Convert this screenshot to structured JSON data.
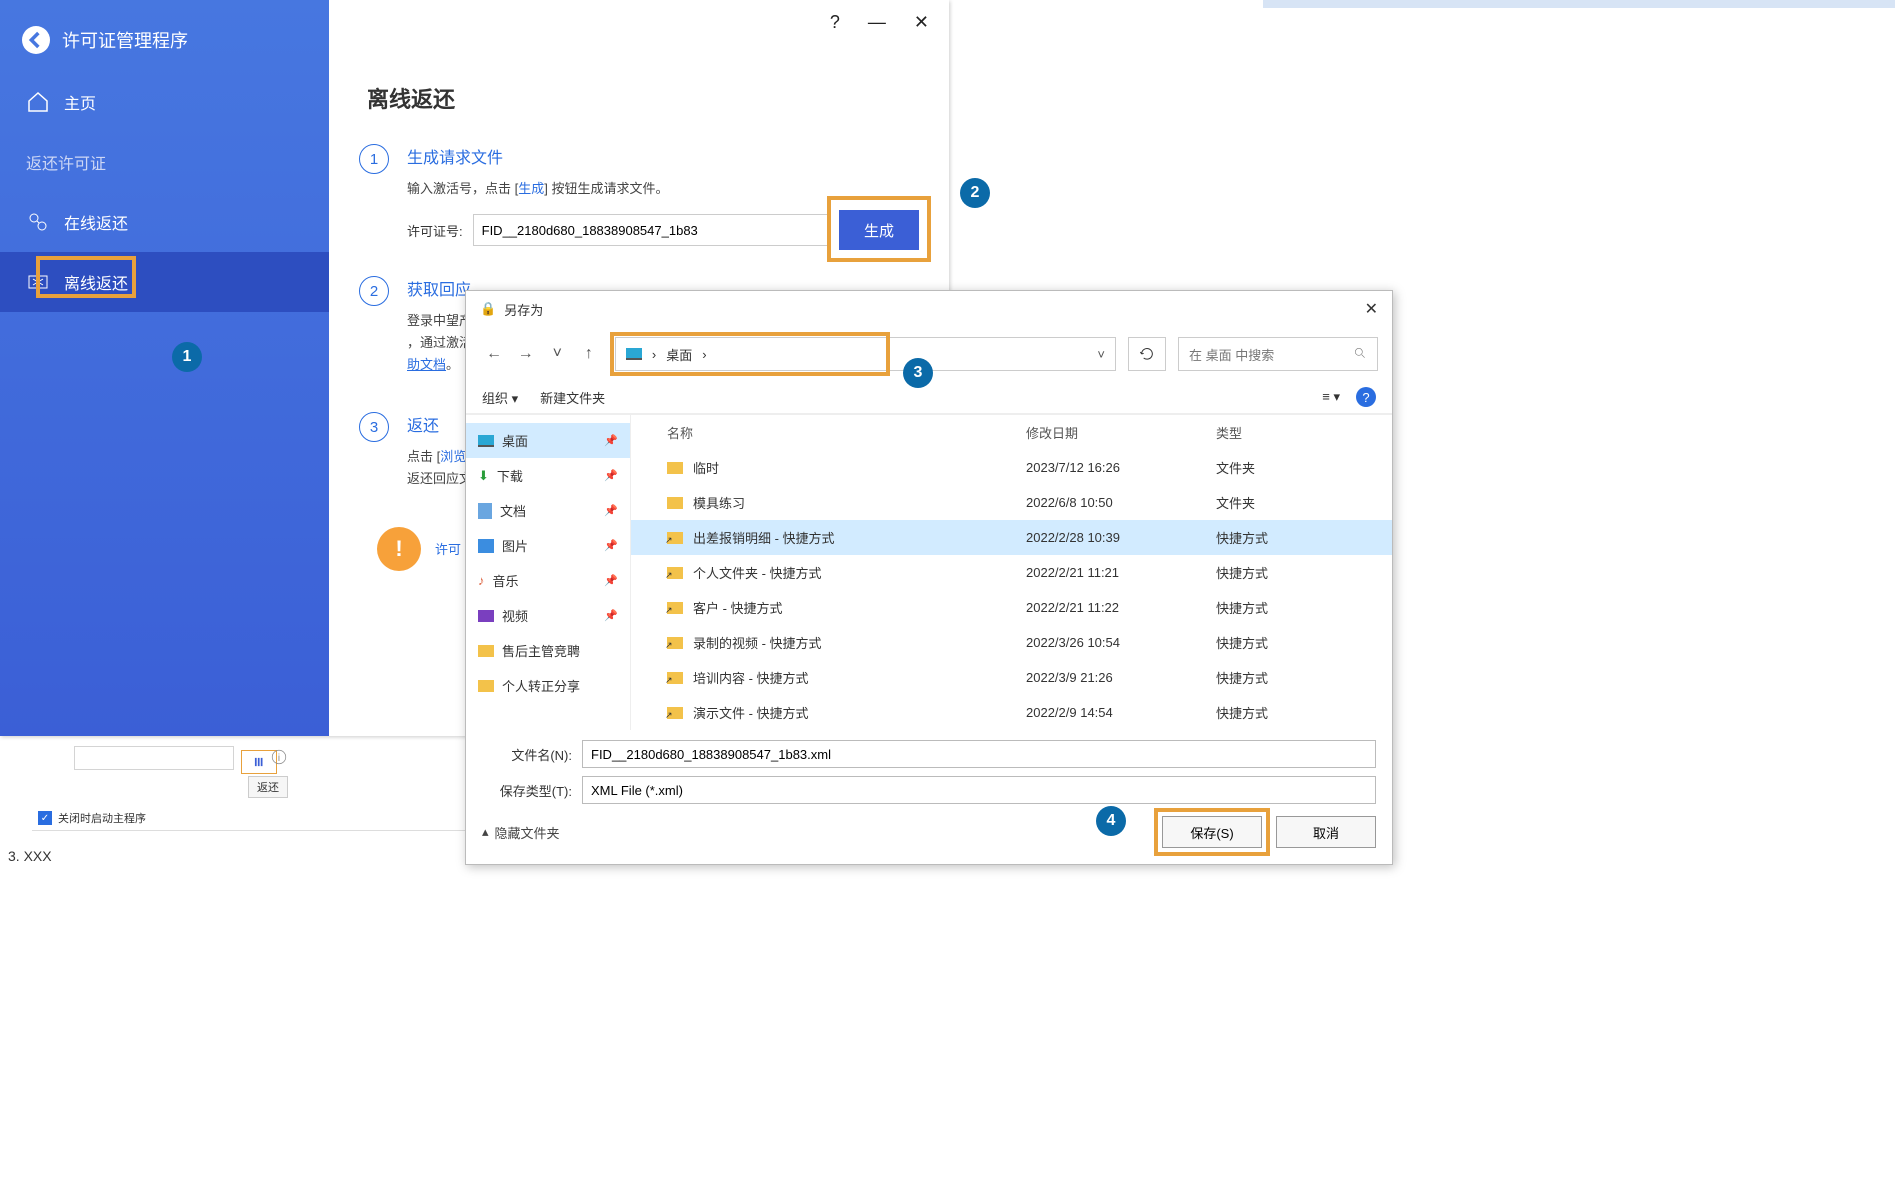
{
  "app": {
    "title": "许可证管理程序",
    "sidebar": {
      "home": "主页",
      "section": "返还许可证",
      "online": "在线返还",
      "offline": "离线返还"
    },
    "window_buttons": {
      "help": "?",
      "min": "—",
      "close": "✕"
    }
  },
  "content": {
    "heading": "离线返还",
    "step1": {
      "title": "生成请求文件",
      "desc_pre": "输入激活号，点击 [",
      "desc_link": "生成",
      "desc_post": "] 按钮生成请求文件。",
      "lic_label": "许可证号:",
      "lic_value": "FID__2180d680_18838908547_1b83",
      "btn": "生成"
    },
    "step2": {
      "title": "获取回应",
      "desc_pre": "登录中望产",
      "desc_post": "，通过激活",
      "link": "助文档"
    },
    "step3": {
      "title": "返还",
      "desc_pre": "点击 [",
      "desc_link": "浏览",
      "desc_post": "]",
      "desc2": "返还回应文"
    },
    "warn_text": "许可"
  },
  "mini": {
    "tooltip": "返还",
    "checkbox_label": "关闭时启动主程序"
  },
  "footer_text": "3. XXX",
  "dialog": {
    "title": "另存为",
    "breadcrumb": {
      "loc": "桌面",
      "sep": "›"
    },
    "search_placeholder": "在 桌面 中搜索",
    "toolbar": {
      "organize": "组织",
      "new_folder": "新建文件夹"
    },
    "tree": [
      {
        "label": "桌面",
        "icon": "desktop",
        "sel": true,
        "pin": true
      },
      {
        "label": "下载",
        "icon": "download",
        "pin": true
      },
      {
        "label": "文档",
        "icon": "doc",
        "pin": true
      },
      {
        "label": "图片",
        "icon": "img",
        "pin": true
      },
      {
        "label": "音乐",
        "icon": "music",
        "pin": true
      },
      {
        "label": "视频",
        "icon": "video",
        "pin": true
      },
      {
        "label": "售后主管竞聘",
        "icon": "folder"
      },
      {
        "label": "个人转正分享",
        "icon": "folder"
      }
    ],
    "columns": {
      "name": "名称",
      "date": "修改日期",
      "type": "类型"
    },
    "files": [
      {
        "name": "临时",
        "date": "2023/7/12 16:26",
        "type": "文件夹",
        "icon": "folder"
      },
      {
        "name": "模具练习",
        "date": "2022/6/8 10:50",
        "type": "文件夹",
        "icon": "folder"
      },
      {
        "name": "出差报销明细 - 快捷方式",
        "date": "2022/2/28 10:39",
        "type": "快捷方式",
        "icon": "shortcut",
        "sel": true
      },
      {
        "name": "个人文件夹 - 快捷方式",
        "date": "2022/2/21 11:21",
        "type": "快捷方式",
        "icon": "shortcut"
      },
      {
        "name": "客户 - 快捷方式",
        "date": "2022/2/21 11:22",
        "type": "快捷方式",
        "icon": "shortcut"
      },
      {
        "name": "录制的视频 - 快捷方式",
        "date": "2022/3/26 10:54",
        "type": "快捷方式",
        "icon": "shortcut"
      },
      {
        "name": "培训内容 - 快捷方式",
        "date": "2022/3/9 21:26",
        "type": "快捷方式",
        "icon": "shortcut"
      },
      {
        "name": "演示文件 - 快捷方式",
        "date": "2022/2/9 14:54",
        "type": "快捷方式",
        "icon": "shortcut"
      }
    ],
    "filename_label": "文件名(N):",
    "filename_value": "FID__2180d680_18838908547_1b83.xml",
    "filetype_label": "保存类型(T):",
    "filetype_value": "XML File (*.xml)",
    "hide_folders": "隐藏文件夹",
    "save_btn": "保存(S)",
    "cancel_btn": "取消"
  },
  "annotations": {
    "a1": "1",
    "a2": "2",
    "a3": "3",
    "a4": "4"
  }
}
